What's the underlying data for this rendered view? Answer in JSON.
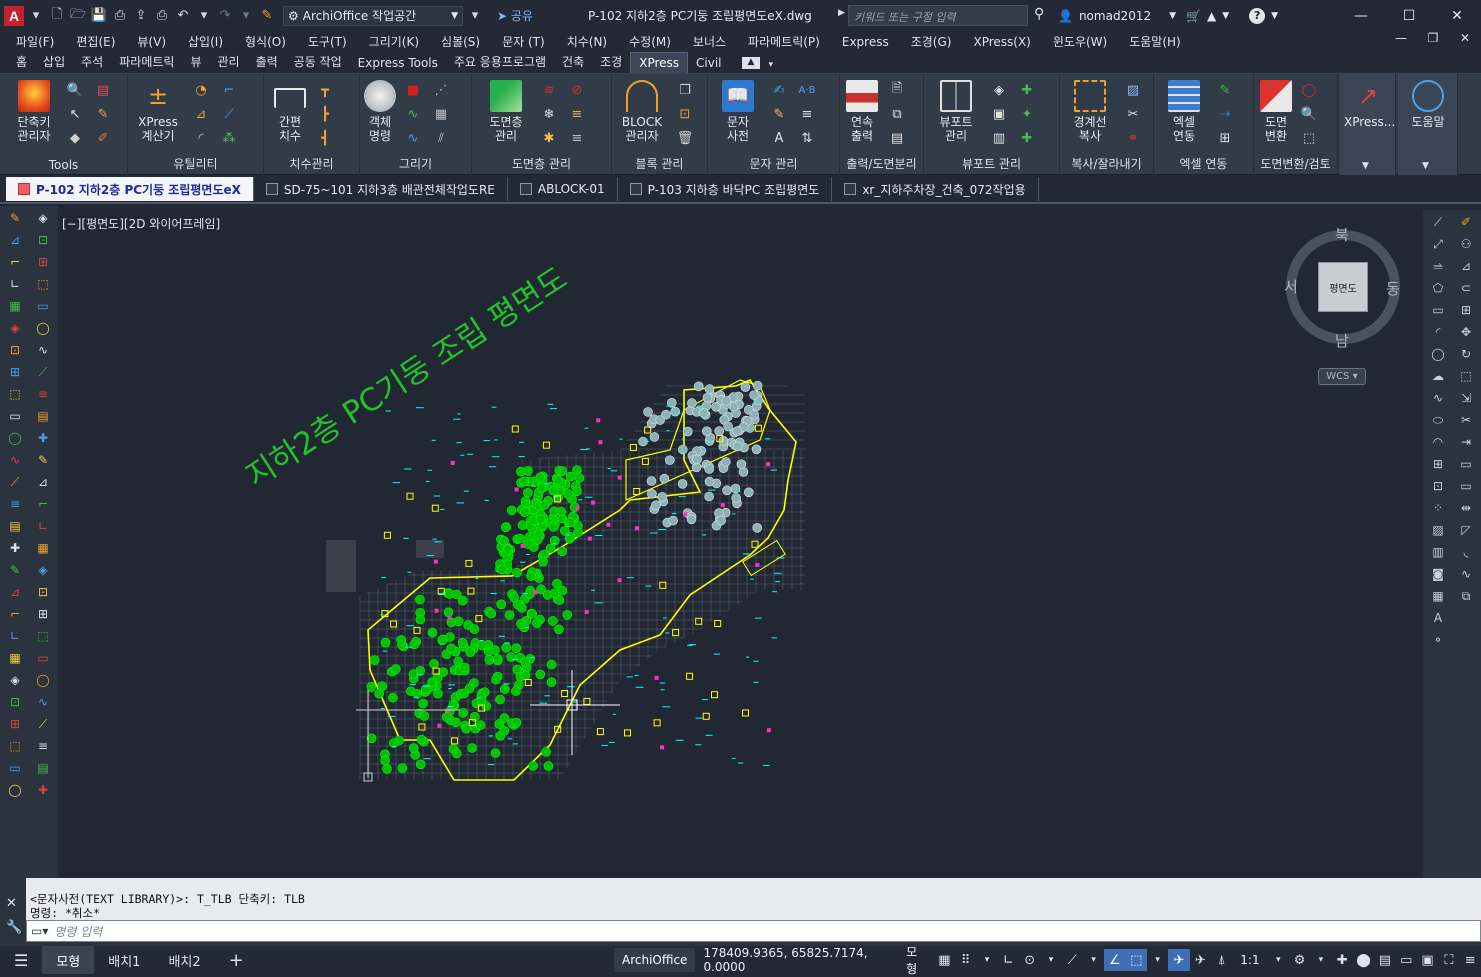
{
  "title_bar": {
    "app_logo": "A",
    "workspace": "ArchiOffice 작업공간",
    "share": "공유",
    "document_title": "P-102 지하2층 PC기둥 조립평면도eX.dwg",
    "search_placeholder": "키워드 또는 구절 입력",
    "user": "nomad2012"
  },
  "menu": [
    "파일(F)",
    "편집(E)",
    "뷰(V)",
    "삽입(I)",
    "형식(O)",
    "도구(T)",
    "그리기(K)",
    "심볼(S)",
    "문자 (T)",
    "치수(N)",
    "수정(M)",
    "보너스",
    "파라메트릭(P)",
    "Express",
    "조경(G)",
    "XPress(X)",
    "윈도우(W)",
    "도움말(H)"
  ],
  "ribbon_tabs": [
    "홈",
    "삽입",
    "주석",
    "파라메트릭",
    "뷰",
    "관리",
    "출력",
    "공동 작업",
    "Express Tools",
    "주요 응용프로그램",
    "건축",
    "조경",
    "XPress",
    "Civil"
  ],
  "active_ribbon_tab": "XPress",
  "ribbon": {
    "tools": {
      "btn1": "단축키",
      "btn1b": "관리자",
      "title": "Tools"
    },
    "util": {
      "btn1": "XPress",
      "btn1b": "계산기",
      "title": "유틸리티"
    },
    "dim": {
      "btn1": "간편",
      "btn1b": "치수",
      "title": "치수관리"
    },
    "draw": {
      "btn1": "객체",
      "btn1b": "명령",
      "title": "그리기"
    },
    "layer": {
      "btn1": "도면층",
      "btn1b": "관리",
      "title": "도면층 관리"
    },
    "block": {
      "btn1": "BLOCK",
      "btn1b": "관리자",
      "title": "블록 관리"
    },
    "text": {
      "btn1": "문자",
      "btn1b": "사전",
      "title": "문자 관리"
    },
    "print": {
      "btn1": "연속",
      "btn1b": "출력",
      "title": "출력/도면분리"
    },
    "viewport": {
      "btn1": "뷰포트",
      "btn1b": "관리",
      "title": "뷰포트 관리"
    },
    "copy": {
      "btn1": "경계선",
      "btn1b": "복사",
      "title": "복사/잘라내기"
    },
    "excel": {
      "btn1": "엑셀",
      "btn1b": "연동",
      "title": "엑셀 연동"
    },
    "conv": {
      "btn1": "도면",
      "btn1b": "변환",
      "title": "도면변환/검토"
    },
    "xpress": {
      "btn1": "XPress..."
    },
    "help": {
      "btn1": "도움말"
    }
  },
  "file_tabs": [
    "P-102 지하2층 PC기둥 조립평면도eX",
    "SD-75~101 지하3층 배관전체작업도RE",
    "ABLOCK-01",
    "P-103 지하층 바닥PC 조립평면도",
    "xr_지하주차장_건축_072작업용"
  ],
  "viewport_label": "[−][평면도][2D 와이어프레임]",
  "drawing_title_text": "지하2층 PC기둥 조립 평면도",
  "viewcube": {
    "north": "북",
    "south": "남",
    "east": "동",
    "west": "서",
    "face": "평면도",
    "wcs": "WCS"
  },
  "command_history": [
    "<문자사전(TEXT LIBRARY)>: T_TLB  단축키: TLB",
    "명령: *취소*"
  ],
  "command_placeholder": "명령 입력",
  "layout_tabs": [
    "모형",
    "배치1",
    "배치2"
  ],
  "status": {
    "app": "ArchiOffice",
    "coords": "178409.9365, 65825.7174, 0.0000",
    "model": "모형",
    "scale": "1:1"
  },
  "colors": {
    "accent": "#3e6eb5",
    "canvas": "#212833",
    "drawing_yellow": "#ffff00",
    "drawing_green": "#00d000",
    "drawing_cyan": "#00ffff",
    "title_green": "#23c22a"
  }
}
